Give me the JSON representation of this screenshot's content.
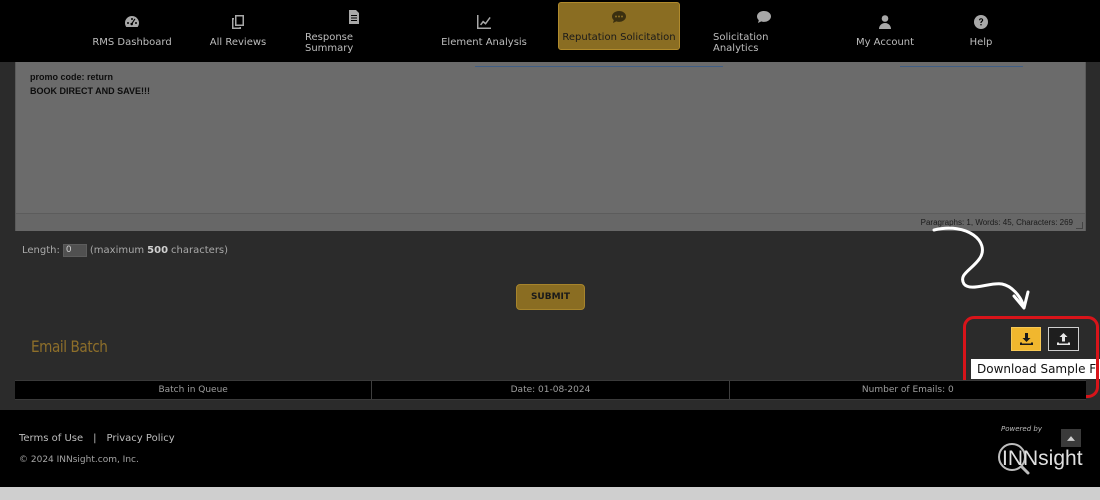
{
  "nav": {
    "items": [
      {
        "label": "RMS Dashboard",
        "icon": "dashboard-icon"
      },
      {
        "label": "All Reviews",
        "icon": "reviews-icon"
      },
      {
        "label": "Response Summary",
        "icon": "document-icon"
      },
      {
        "label": "Element Analysis",
        "icon": "line-chart-icon"
      },
      {
        "label": "Reputation Solicitation",
        "icon": "chat-bubble-icon",
        "active": true
      },
      {
        "label": "Solicitation Analytics",
        "icon": "speech-bubble-icon"
      },
      {
        "label": "My Account",
        "icon": "user-icon"
      },
      {
        "label": "Help",
        "icon": "question-icon"
      }
    ]
  },
  "editor": {
    "lines": [
      "promo code: return",
      "BOOK DIRECT AND SAVE!!!"
    ],
    "status": "Paragraphs: 1, Words: 45, Characters: 269"
  },
  "length": {
    "label": "Length:",
    "value": "0",
    "note_prefix": "(maximum",
    "max": "500",
    "note_suffix": "characters)"
  },
  "submit_label": "SUBMIT",
  "email_batch": {
    "title": "Email Batch",
    "tooltip": "Download Sample F",
    "table": {
      "cells": [
        "Batch in Queue",
        "Date: 01-08-2024",
        "Number of Emails: 0"
      ]
    }
  },
  "footer": {
    "terms": "Terms of Use",
    "separator": "|",
    "privacy": "Privacy Policy",
    "copyright": "© 2024 INNsight.com, Inc.",
    "powered_by": "Powered by",
    "logo_text": "INNsight"
  },
  "colors": {
    "accent": "#8a6d22",
    "download_button": "#f1b72e",
    "highlight": "#d8141a"
  }
}
